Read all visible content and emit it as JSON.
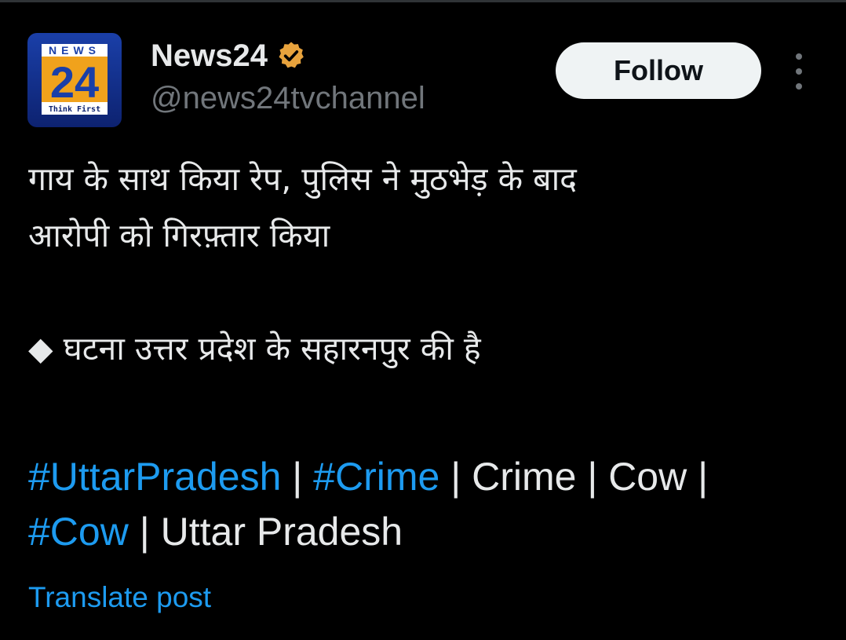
{
  "account": {
    "display_name": "News24",
    "handle": "@news24tvchannel",
    "verified": true,
    "verified_color": "#E8A33D",
    "avatar": {
      "top_text": "NEWS",
      "number": "24",
      "tagline": "Think First"
    }
  },
  "actions": {
    "follow_label": "Follow",
    "more_icon": "more-vertical-icon"
  },
  "post": {
    "line1": "गाय के साथ किया रेप, पुलिस ने मुठभेड़ के बाद",
    "line2": "आरोपी को गिरफ़्तार किया",
    "bullet_glyph": "◆",
    "bullet_text": "घटना उत्तर प्रदेश के सहारनपुर की है",
    "tags": {
      "tag1": "#UttarPradesh",
      "sep1": " | ",
      "tag2": "#Crime",
      "sep2": " | ",
      "text1": "Crime",
      "sep3": " | ",
      "text2": "Cow",
      "sep4": " |",
      "tag3": "#Cow",
      "sep5": " | ",
      "text3": "Uttar Pradesh"
    }
  },
  "translate_label": "Translate post",
  "colors": {
    "background": "#000000",
    "text": "#E7E9EA",
    "secondary": "#71767B",
    "link": "#1D9BF0",
    "button_bg": "#EFF3F4",
    "button_text": "#0F1419"
  }
}
